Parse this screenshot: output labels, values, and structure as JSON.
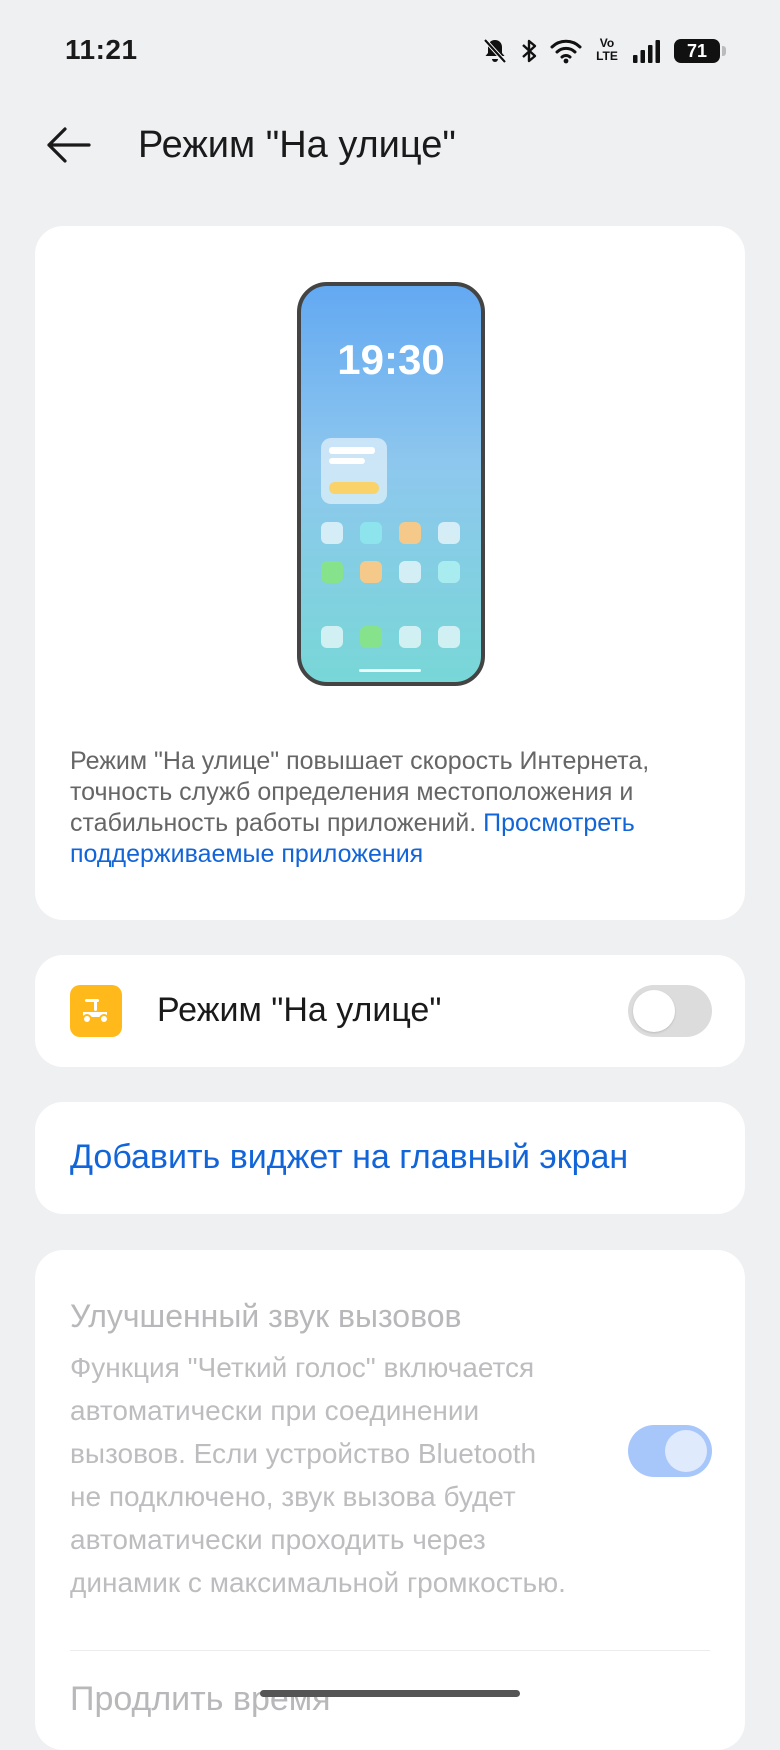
{
  "status_bar": {
    "time": "11:21",
    "battery_level": "71",
    "volte_label_top": "Vo",
    "volte_label_bottom": "LTE",
    "icons": [
      "bell-off-icon",
      "bluetooth-icon",
      "wifi-icon",
      "volte-icon",
      "signal-icon",
      "battery-icon"
    ]
  },
  "header": {
    "back_icon": "arrow-left-icon",
    "title": "Режим \"На улице\""
  },
  "intro_card": {
    "illustration": {
      "phone_time": "19:30"
    },
    "description": "Режим \"На улице\" повышает скорость Интернета, точность служб определения местоположения и стабильность работы приложений.",
    "link_text": "Просмотреть поддерживаемые приложения"
  },
  "mode_toggle": {
    "icon": "scooter-icon",
    "label": "Режим \"На улице\"",
    "enabled": false
  },
  "widget_card": {
    "link_text": "Добавить виджет на главный экран"
  },
  "sound_card": {
    "title": "Улучшенный звук вызовов",
    "description": "Функция \"Четкий голос\" включается автоматически при соединении вызовов. Если устройство Bluetooth не подключено, звук вызова будет автоматически проходить через динамик с максимальной громкостью.",
    "enabled": true,
    "disabled_state": true,
    "next_item_label": "Продлить время"
  },
  "colors": {
    "background": "#eff0f2",
    "card": "#ffffff",
    "accent": "#1265d8",
    "mode_icon_bg": "#ffb91a",
    "switch_off": "#dcdcdc",
    "switch_on_disabled": "#a7c7fb"
  }
}
